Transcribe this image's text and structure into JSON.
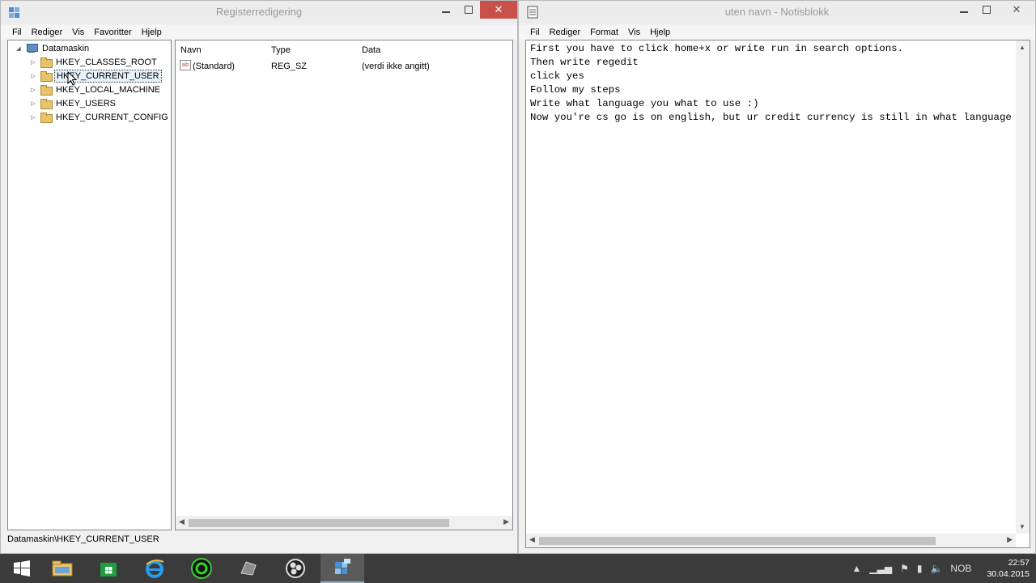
{
  "regedit": {
    "title": "Registerredigering",
    "menu": [
      "Fil",
      "Rediger",
      "Vis",
      "Favoritter",
      "Hjelp"
    ],
    "tree": {
      "root": "Datamaskin",
      "items": [
        "HKEY_CLASSES_ROOT",
        "HKEY_CURRENT_USER",
        "HKEY_LOCAL_MACHINE",
        "HKEY_USERS",
        "HKEY_CURRENT_CONFIG"
      ],
      "selected": "HKEY_CURRENT_USER"
    },
    "columns": {
      "name": "Navn",
      "type": "Type",
      "data": "Data"
    },
    "rows": [
      {
        "name": "(Standard)",
        "type": "REG_SZ",
        "data": "(verdi ikke angitt)"
      }
    ],
    "status": "Datamaskin\\HKEY_CURRENT_USER",
    "close_glyph": "✕",
    "expanded_glyph": "◢",
    "collapsed_glyph": "▷",
    "value_icon_text": "ab"
  },
  "notepad": {
    "title": "uten navn - Notisblokk",
    "menu": [
      "Fil",
      "Rediger",
      "Format",
      "Vis",
      "Hjelp"
    ],
    "lines": [
      "First you have to click home+x or write run in search options.",
      "Then write regedit",
      "click yes",
      "Follow my steps",
      "Write what language you what to use :)",
      "Now you're cs go is on english, but ur credit currency is still in what language"
    ],
    "close_glyph": "✕"
  },
  "taskbar": {
    "items": [
      "start-button",
      "file-explorer",
      "store",
      "internet-explorer",
      "razer-app",
      "app-gray",
      "obs-app",
      "regedit-app"
    ],
    "active": "regedit-app",
    "tray": {
      "language": "NOB",
      "time": "22:57",
      "date": "30.04.2015"
    }
  },
  "colors": {
    "close_red": "#c7514a",
    "taskbar": "#3b3b3b",
    "folder": "#e7c36b"
  }
}
